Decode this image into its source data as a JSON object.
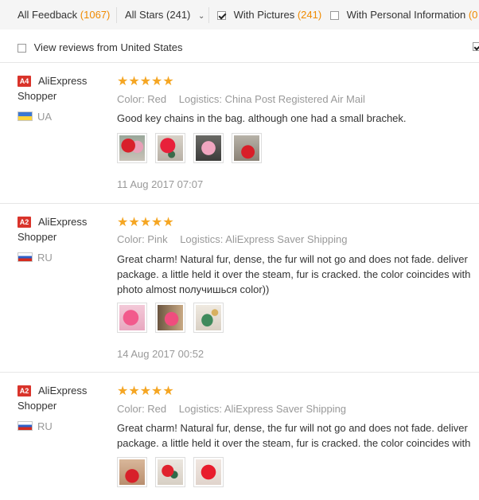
{
  "filters": {
    "all_feedback_label": "All Feedback",
    "all_feedback_count": "(1067)",
    "all_stars_label": "All Stars",
    "all_stars_count": "(241)",
    "with_pictures_label": "With Pictures",
    "with_pictures_count": "(241)",
    "with_personal_label": "With Personal Information",
    "with_personal_count": "(0",
    "view_us_label": "View reviews from United States"
  },
  "reviews": [
    {
      "badge": "A4",
      "name": "AliExpress Shopper",
      "country": "UA",
      "flag": "ua-flag",
      "stars": "★★★★★",
      "rating": 5,
      "color": "Color: Red",
      "logistics": "Logistics: China Post Registered Air Mail",
      "lines": [
        "Good key chains in the bag. although one had a small brachek."
      ],
      "date": "11 Aug 2017 07:07",
      "photo_count": 4
    },
    {
      "badge": "A2",
      "name": "AliExpress Shopper",
      "country": "RU",
      "flag": "ru-flag",
      "stars": "★★★★★",
      "rating": 5,
      "color": "Color: Pink",
      "logistics": "Logistics: AliExpress Saver Shipping",
      "lines": [
        "Great charm! Natural fur, dense, the fur will not go and does not fade. deliver",
        "package. a little held it over the steam, fur is cracked. the color coincides with",
        "photo almost получишься color))"
      ],
      "date": "14 Aug 2017 00:52",
      "photo_count": 3
    },
    {
      "badge": "A2",
      "name": "AliExpress Shopper",
      "country": "RU",
      "flag": "ru-flag",
      "stars": "★★★★★",
      "rating": 5,
      "color": "Color: Red",
      "logistics": "Logistics: AliExpress Saver Shipping",
      "lines": [
        "Great charm! Natural fur, dense, the fur will not go and does not fade. deliver",
        "package. a little held it over the steam, fur is cracked. the color coincides with"
      ],
      "photo_count": 3
    }
  ],
  "colors": {
    "accent_orange": "#f08a00",
    "star": "#f5a623",
    "badge_red": "#d9342b",
    "muted": "#999999"
  }
}
